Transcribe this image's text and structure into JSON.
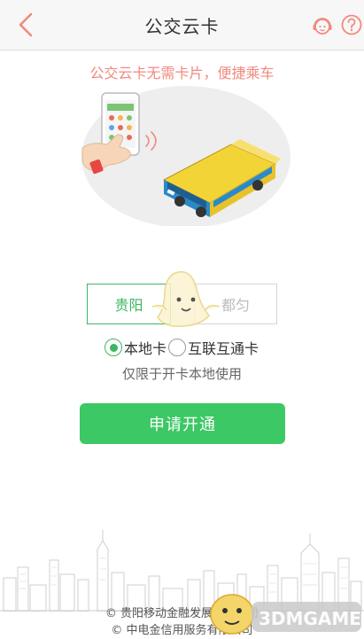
{
  "header": {
    "title": "公交云卡",
    "back_icon": "chevron-left-icon",
    "service_icon": "customer-service-icon",
    "help_icon": "question-mark-icon",
    "accent_color": "#f08a80"
  },
  "slogan": "公交云卡无需卡片，便捷乘车",
  "city_tabs": [
    {
      "label": "贵阳",
      "selected": true
    },
    {
      "label": "都匀",
      "selected": false
    }
  ],
  "card_types": [
    {
      "label": "本地卡",
      "selected": true
    },
    {
      "label": "互联互通卡",
      "selected": false
    }
  ],
  "note": "仅限于开卡本地使用",
  "apply_button": {
    "label": "申请开通",
    "color": "#3cc864"
  },
  "footer": {
    "copyright_lines": [
      "© 贵阳移动金融发展有限公司",
      "© 中电金信用服务有限公司"
    ]
  },
  "watermark": {
    "text": "3DMGAME"
  }
}
